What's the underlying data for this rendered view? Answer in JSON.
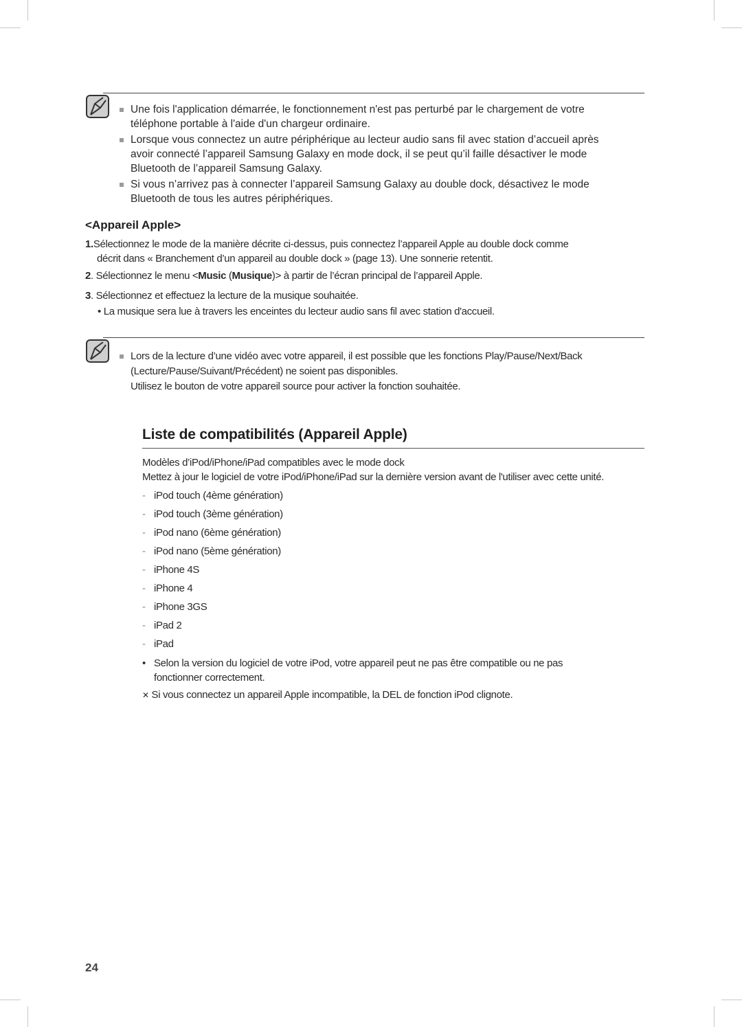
{
  "note1": {
    "items": [
      {
        "lines": [
          "Une fois l'application démarrée, le fonctionnement n'est pas perturbé par le chargement de votre",
          "téléphone portable à l'aide d'un chargeur ordinaire."
        ]
      },
      {
        "lines": [
          "Lorsque vous connectez un autre périphérique au lecteur audio sans fil avec station d’accueil après",
          "avoir connecté l’appareil Samsung Galaxy en mode dock, il se peut qu’il faille désactiver le mode",
          "Bluetooth de l’appareil Samsung Galaxy."
        ]
      },
      {
        "lines": [
          "Si vous n’arrivez pas à connecter l’appareil Samsung Galaxy au double dock, désactivez le mode",
          "Bluetooth de tous les autres périphériques."
        ]
      }
    ]
  },
  "apple_section": {
    "heading": "<Appareil Apple>",
    "steps": [
      {
        "num": "1.",
        "lines": [
          "Sélectionnez le mode de la manière décrite ci-dessus, puis connectez l’appareil Apple au double dock comme",
          "décrit dans « Branchement d’un appareil au double dock » (page 13). Une sonnerie retentit."
        ]
      },
      {
        "num": "2",
        "pre": ". Sélectionnez le menu <",
        "bold1": "Music",
        "mid": " (",
        "bold2": "Musique",
        "post": ")> à partir de l’écran principal de l’appareil Apple."
      },
      {
        "num": "3",
        "text": ". Sélectionnez et effectuez la lecture de la musique souhaitée."
      }
    ],
    "bullet": "La musique sera lue à travers les enceintes du lecteur audio sans fil avec station d'accueil."
  },
  "note2": {
    "lines": [
      "Lors de la lecture d’une vidéo avec votre appareil, il est possible que les fonctions Play/Pause/Next/Back",
      "(Lecture/Pause/Suivant/Précédent) ne soient pas disponibles.",
      "Utilisez le bouton de votre appareil source pour activer la fonction souhaitée."
    ]
  },
  "compat": {
    "title": "Liste de compatibilités (Appareil Apple)",
    "intro": [
      "Modèles d’iPod/iPhone/iPad compatibles avec le mode dock",
      "Mettez à jour le logiciel de votre iPod/iPhone/iPad sur la dernière version avant de l'utiliser avec cette unité."
    ],
    "models": [
      "iPod touch (4ème génération)",
      "iPod touch (3ème génération)",
      "iPod nano (6ème génération)",
      "iPod nano (5ème génération)",
      "iPhone 4S",
      "iPhone 4",
      "iPhone 3GS",
      "iPad 2",
      "iPad"
    ],
    "dash": "-",
    "bullet_lines": [
      "Selon la version du logiciel de votre iPod, votre appareil peut ne pas être compatible ou ne pas",
      "fonctionner correctement."
    ],
    "warning_mark": "✕",
    "warning": "Si vous connectez un appareil Apple incompatible, la DEL de fonction iPod clignote."
  },
  "page_number": "24"
}
